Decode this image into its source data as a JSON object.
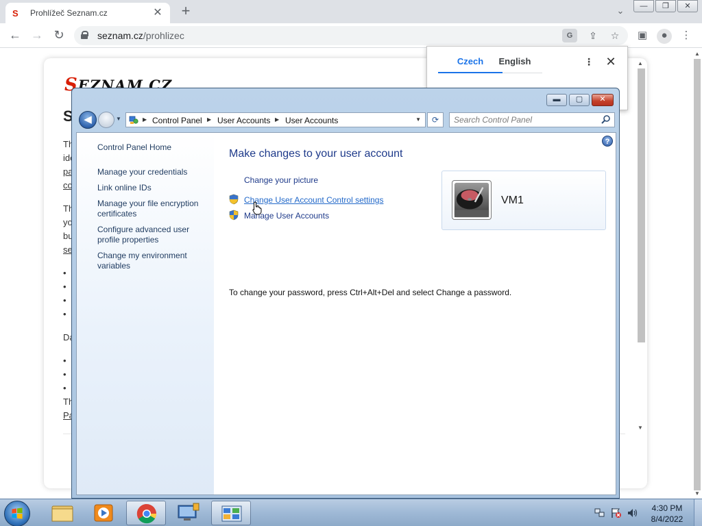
{
  "browser": {
    "tab": {
      "favicon": "S",
      "title": "Prohlížeč Seznam.cz",
      "close": "✕"
    },
    "new_tab": "+",
    "tab_search": "⌄",
    "window_controls": {
      "minimize": "—",
      "restore": "❐",
      "close": "✕"
    },
    "nav": {
      "back": "←",
      "forward": "→",
      "reload": "↻"
    },
    "url": {
      "host": "seznam.cz",
      "path": "/prohlizec"
    },
    "toolbar_icons": {
      "translate": "G",
      "share": "⇪",
      "bookmark": "☆",
      "side_panel": "▣",
      "profile": "●",
      "menu": "⋮"
    }
  },
  "page": {
    "logo_letter": "S",
    "logo_text": "EZNAM.CZ",
    "heading_sliver": "S",
    "lines": [
      {
        "text": "Th",
        "link": false
      },
      {
        "text": "ide",
        "link": false
      },
      {
        "text": "pa",
        "link": true
      },
      {
        "text": "co",
        "link": true
      },
      {
        "text": "Th",
        "link": false
      },
      {
        "text": "yo",
        "link": false
      },
      {
        "text": "bu",
        "link": false
      },
      {
        "text": "se",
        "link": true
      },
      {
        "text": "•",
        "link": false
      },
      {
        "text": "•",
        "link": false
      },
      {
        "text": "•",
        "link": false
      },
      {
        "text": "•",
        "link": false
      },
      {
        "text": "Da",
        "link": false
      },
      {
        "text": "•",
        "link": false
      },
      {
        "text": "•",
        "link": false
      },
      {
        "text": "•",
        "link": false
      },
      {
        "text": "Th",
        "link": false
      },
      {
        "text": "Pa",
        "link": true
      }
    ]
  },
  "translate_popup": {
    "tab_source": "Czech",
    "tab_target": "English",
    "more": "⋮",
    "close": "✕"
  },
  "control_panel": {
    "caption_buttons": {
      "minimize": "▬",
      "maximize": "▢",
      "close": "✕"
    },
    "nav": {
      "back": "◀",
      "history": "▼",
      "refresh": "⟳"
    },
    "breadcrumb": [
      "Control Panel",
      "User Accounts",
      "User Accounts"
    ],
    "address_dropdown": "▼",
    "search_placeholder": "Search Control Panel",
    "sidebar": [
      "Control Panel Home",
      "Manage your credentials",
      "Link online IDs",
      "Manage your file encryption certificates",
      "Configure advanced user profile properties",
      "Change my environment variables"
    ],
    "help": "?",
    "title": "Make changes to your user account",
    "tasks": [
      "Change your picture",
      "Change User Account Control settings",
      "Manage User Accounts"
    ],
    "password_note": "To change your password, press Ctrl+Alt+Del and select Change a password.",
    "user": {
      "name": "VM1"
    }
  },
  "taskbar": {
    "time": "4:30 PM",
    "date": "8/4/2022",
    "tray_icons": [
      "network-icon",
      "action-center-icon",
      "volume-icon"
    ]
  },
  "colors": {
    "link_blue": "#1e3a8a",
    "hover_link": "#2168c9",
    "seznam_red": "#d81e05",
    "translate_blue": "#1a73e8"
  }
}
